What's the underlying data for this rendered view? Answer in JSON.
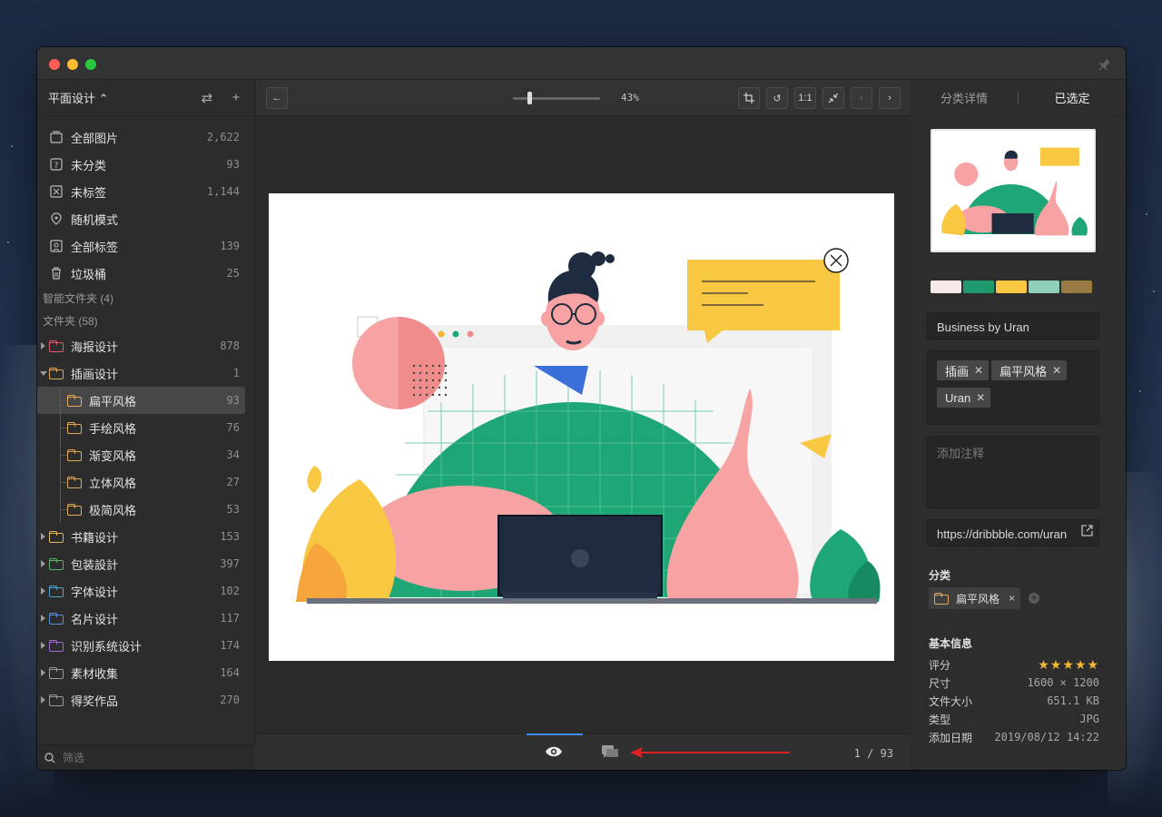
{
  "window": {
    "traffic_colors": [
      "#ff5f57",
      "#febc2e",
      "#28c840"
    ]
  },
  "sidebar": {
    "library_name": "平面设计 ⌃",
    "items": [
      {
        "label": "全部图片",
        "count": "2,622",
        "icon": "all-images-icon"
      },
      {
        "label": "未分类",
        "count": "93",
        "icon": "uncategorized-icon"
      },
      {
        "label": "未标签",
        "count": "1,144",
        "icon": "untagged-icon"
      },
      {
        "label": "随机模式",
        "count": "",
        "icon": "random-mode-icon"
      },
      {
        "label": "全部标签",
        "count": "139",
        "icon": "all-tags-icon"
      },
      {
        "label": "垃圾桶",
        "count": "25",
        "icon": "trash-icon"
      }
    ],
    "smart_folders_label": "智能文件夹 (4)",
    "folders_label": "文件夹 (58)",
    "folders": [
      {
        "label": "海报设计",
        "count": "878",
        "color": "#e05b6b"
      },
      {
        "label": "插画设计",
        "count": "1",
        "color": "#e0a95b",
        "expanded": true,
        "children": [
          {
            "label": "扁平风格",
            "count": "93",
            "color": "#e0a95b",
            "selected": true
          },
          {
            "label": "手绘风格",
            "count": "76",
            "color": "#e0a95b"
          },
          {
            "label": "渐变风格",
            "count": "34",
            "color": "#e0a95b"
          },
          {
            "label": "立体风格",
            "count": "27",
            "color": "#e0a95b"
          },
          {
            "label": "极简风格",
            "count": "53",
            "color": "#e0a95b"
          }
        ]
      },
      {
        "label": "书籍设计",
        "count": "153",
        "color": "#e2b45a"
      },
      {
        "label": "包装設計",
        "count": "397",
        "color": "#58b36a"
      },
      {
        "label": "字体设计",
        "count": "102",
        "color": "#4ba3c8"
      },
      {
        "label": "名片设计",
        "count": "117",
        "color": "#5a8fd6"
      },
      {
        "label": "识别系统设计",
        "count": "174",
        "color": "#a06ad0"
      },
      {
        "label": "素材收集",
        "count": "164",
        "color": "#9a9a9a"
      },
      {
        "label": "得奖作品",
        "count": "270",
        "color": "#9a9a9a"
      }
    ],
    "filter_placeholder": "筛选"
  },
  "toolbar": {
    "zoom": "43%",
    "zoom_level": 0.2
  },
  "viewer": {
    "pager": "1 / 93"
  },
  "details": {
    "tabs": [
      "分类详情",
      "已选定"
    ],
    "palette": [
      "#f6e9ea",
      "#1f9a6e",
      "#f9c843",
      "#8fcfba",
      "#9a7a43"
    ],
    "title": "Business by Uran",
    "tags": [
      "插画",
      "扁平风格",
      "Uran"
    ],
    "note_placeholder": "添加注释",
    "url": "https://dribbble.com/uran",
    "category_label": "分类",
    "category": "扁平风格",
    "basic_info_label": "基本信息",
    "info": [
      {
        "key": "评分",
        "value": ""
      },
      {
        "key": "尺寸",
        "value": "1600 × 1200"
      },
      {
        "key": "文件大小",
        "value": "651.1 KB"
      },
      {
        "key": "类型",
        "value": "JPG"
      },
      {
        "key": "添加日期",
        "value": "2019/08/12 14:22"
      }
    ],
    "rating": 5,
    "rating_color": "#f5b731"
  }
}
